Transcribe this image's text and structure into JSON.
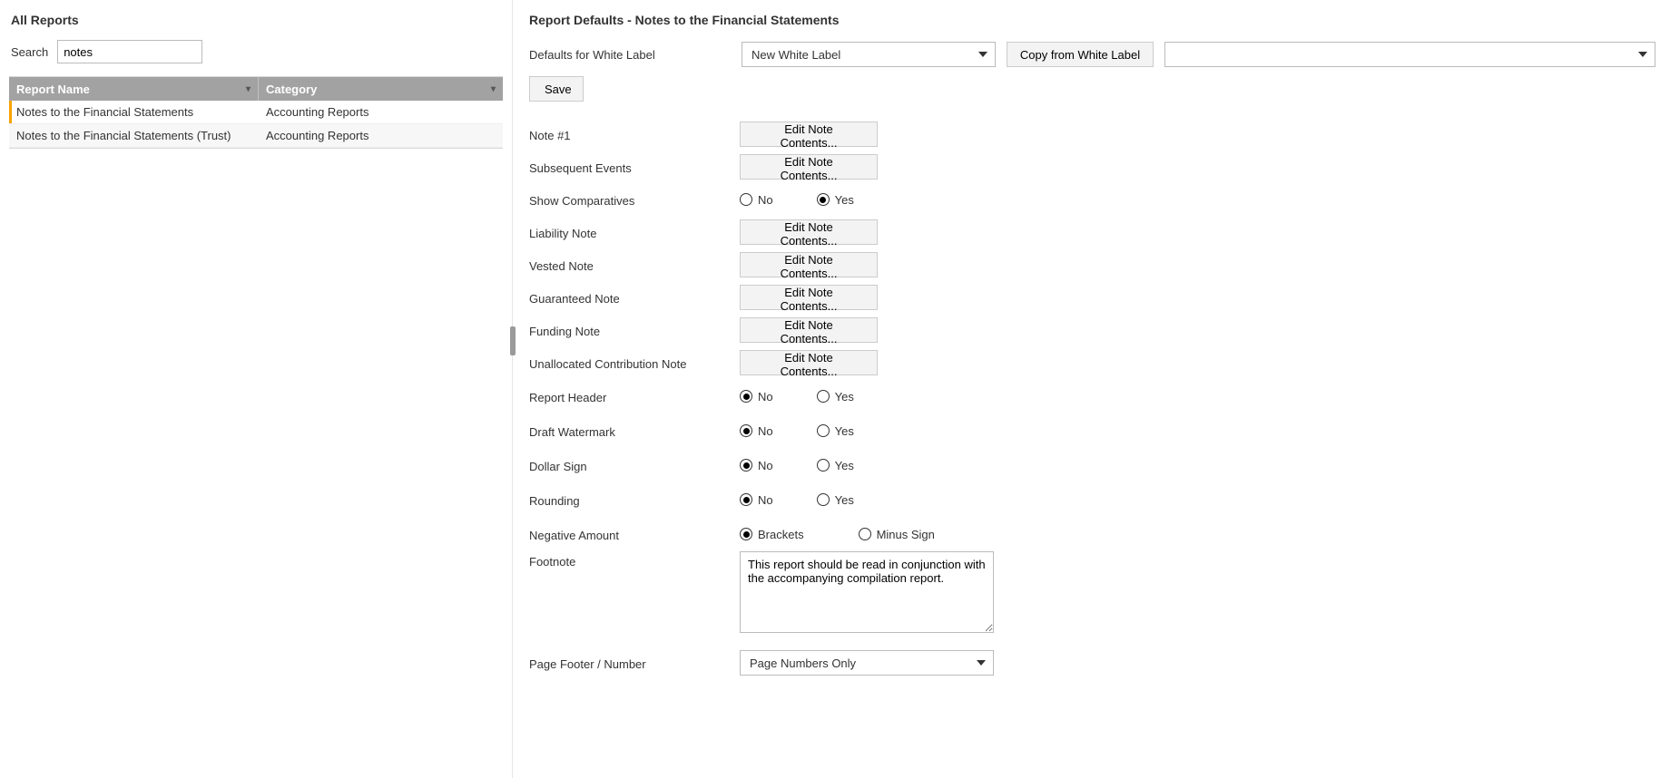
{
  "left": {
    "title": "All Reports",
    "search_label": "Search",
    "search_value": "notes",
    "columns": {
      "name": "Report Name",
      "category": "Category"
    },
    "rows": [
      {
        "name": "Notes to the Financial Statements",
        "category": "Accounting Reports",
        "selected": true
      },
      {
        "name": "Notes to the Financial Statements (Trust)",
        "category": "Accounting Reports",
        "selected": false
      }
    ]
  },
  "right": {
    "title": "Report Defaults - Notes to the Financial Statements",
    "defaults_label": "Defaults for White Label",
    "white_label_selected": "New White Label",
    "copy_button": "Copy from White Label",
    "save_button": "Save",
    "edit_button": "Edit Note Contents...",
    "no_label": "No",
    "yes_label": "Yes",
    "brackets_label": "Brackets",
    "minus_label": "Minus Sign",
    "fields": {
      "note1": "Note #1",
      "subsequent": "Subsequent Events",
      "show_comparatives": "Show Comparatives",
      "liability": "Liability Note",
      "vested": "Vested Note",
      "guaranteed": "Guaranteed Note",
      "funding": "Funding Note",
      "unallocated": "Unallocated Contribution Note",
      "report_header": "Report Header",
      "draft_watermark": "Draft Watermark",
      "dollar_sign": "Dollar Sign",
      "rounding": "Rounding",
      "negative_amount": "Negative Amount",
      "footnote": "Footnote",
      "page_footer": "Page Footer / Number"
    },
    "radio_values": {
      "show_comparatives": "Yes",
      "report_header": "No",
      "draft_watermark": "No",
      "dollar_sign": "No",
      "rounding": "No",
      "negative_amount": "Brackets"
    },
    "footnote_text": "This report should be read in conjunction with the accompanying compilation report.",
    "page_footer_selected": "Page Numbers Only"
  }
}
